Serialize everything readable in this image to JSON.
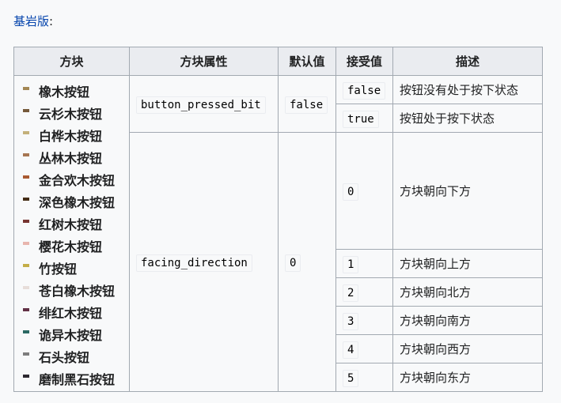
{
  "edition": {
    "label": "基岩版",
    "suffix": ":"
  },
  "table": {
    "headers": [
      "方块",
      "方块属性",
      "默认值",
      "接受值",
      "描述"
    ],
    "blocks": [
      {
        "name": "橡木按钮",
        "color": "#a38754"
      },
      {
        "name": "云杉木按钮",
        "color": "#75593a"
      },
      {
        "name": "白桦木按钮",
        "color": "#c4b17a"
      },
      {
        "name": "丛林木按钮",
        "color": "#a77652"
      },
      {
        "name": "金合欢木按钮",
        "color": "#a95a31"
      },
      {
        "name": "深色橡木按钮",
        "color": "#452d16"
      },
      {
        "name": "红树木按钮",
        "color": "#773431"
      },
      {
        "name": "樱花木按钮",
        "color": "#e8b5ae"
      },
      {
        "name": "竹按钮",
        "color": "#c4ae48"
      },
      {
        "name": "苍白橡木按钮",
        "color": "#e7ddd9"
      },
      {
        "name": "绯红木按钮",
        "color": "#623146"
      },
      {
        "name": "诡异木按钮",
        "color": "#2b6963"
      },
      {
        "name": "石头按钮",
        "color": "#7d7d7d"
      },
      {
        "name": "磨制黑石按钮",
        "color": "#2c2830"
      }
    ],
    "props": [
      {
        "name": "button_pressed_bit",
        "default": "false",
        "values": [
          {
            "value": "false",
            "desc": "按钮没有处于按下状态"
          },
          {
            "value": "true",
            "desc": "按钮处于按下状态"
          }
        ]
      },
      {
        "name": "facing_direction",
        "default": "0",
        "values": [
          {
            "value": "0",
            "desc": "方块朝向下方"
          },
          {
            "value": "1",
            "desc": "方块朝向上方"
          },
          {
            "value": "2",
            "desc": "方块朝向北方"
          },
          {
            "value": "3",
            "desc": "方块朝向南方"
          },
          {
            "value": "4",
            "desc": "方块朝向西方"
          },
          {
            "value": "5",
            "desc": "方块朝向东方"
          }
        ]
      }
    ]
  }
}
